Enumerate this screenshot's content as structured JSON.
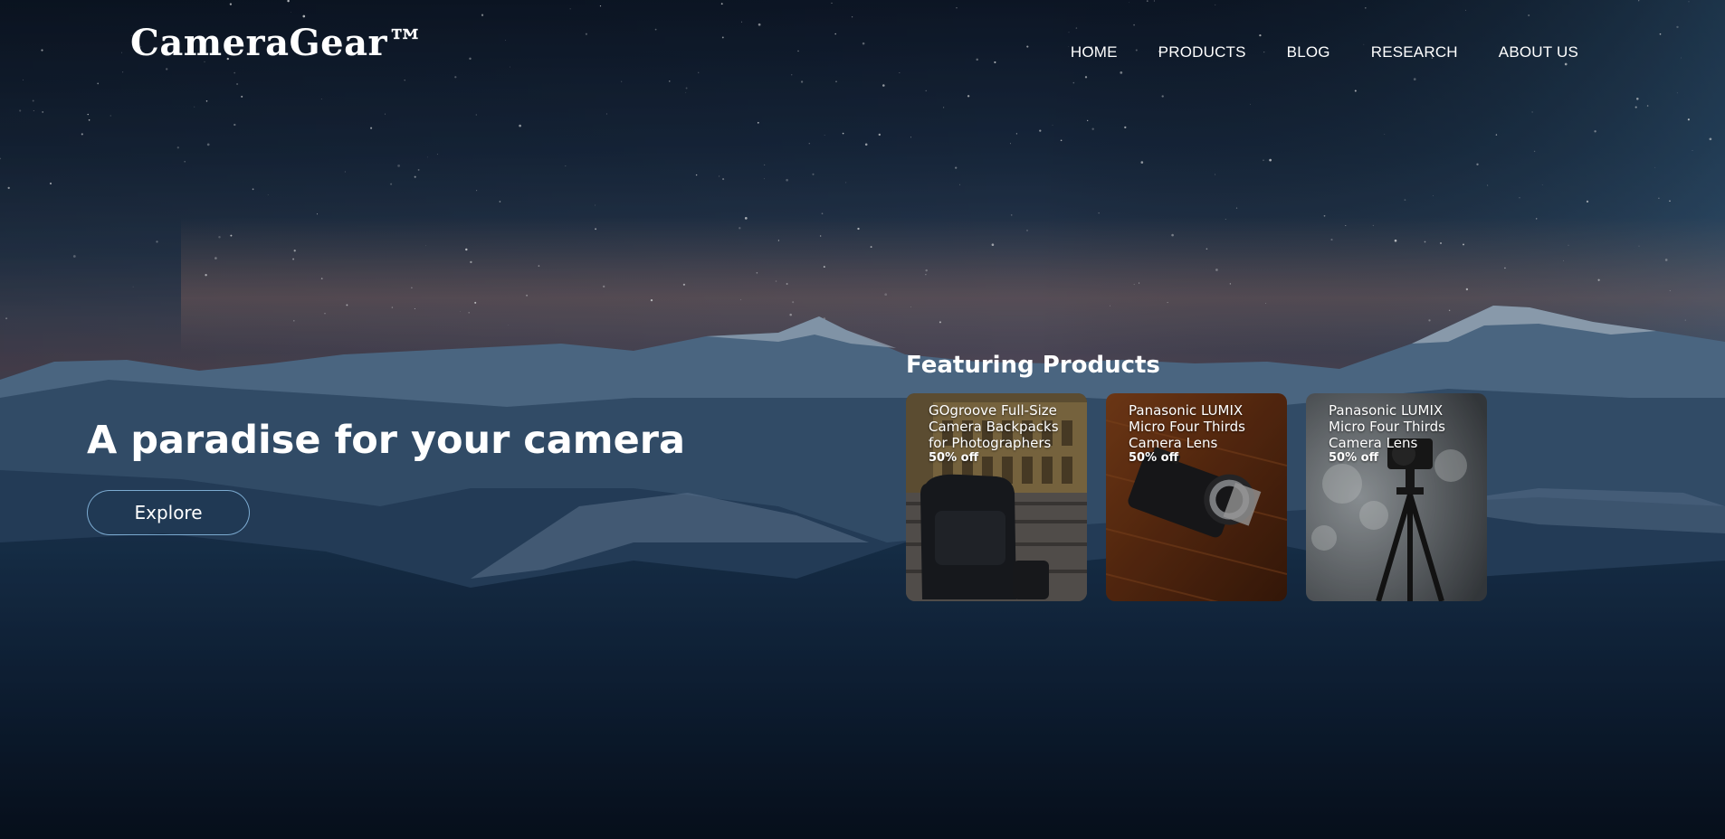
{
  "brand": {
    "logo": "CameraGear™"
  },
  "nav": {
    "items": [
      {
        "label": "HOME"
      },
      {
        "label": "PRODUCTS"
      },
      {
        "label": "BLOG"
      },
      {
        "label": "RESEARCH"
      },
      {
        "label": "ABOUT US"
      }
    ]
  },
  "hero": {
    "title": "A paradise for your camera",
    "cta_label": "Explore"
  },
  "featuring": {
    "title": "Featuring Products",
    "products": [
      {
        "name": "GOgroove Full-Size Camera Backpacks for Photographers",
        "discount": "50% off",
        "image": "backpack-photo"
      },
      {
        "name": "Panasonic LUMIX Micro Four Thirds Camera Lens",
        "discount": "50% off",
        "image": "camera-on-wood-photo"
      },
      {
        "name": "Panasonic LUMIX Micro Four Thirds Camera Lens",
        "discount": "50% off",
        "image": "camera-on-tripod-photo"
      }
    ]
  },
  "colors": {
    "sky_top": "#101a2c",
    "sky_horizon": "#7a5a5e",
    "mountain": "#4a6787",
    "forest": "#0c1a2c",
    "button_border": "#8cbee6"
  }
}
